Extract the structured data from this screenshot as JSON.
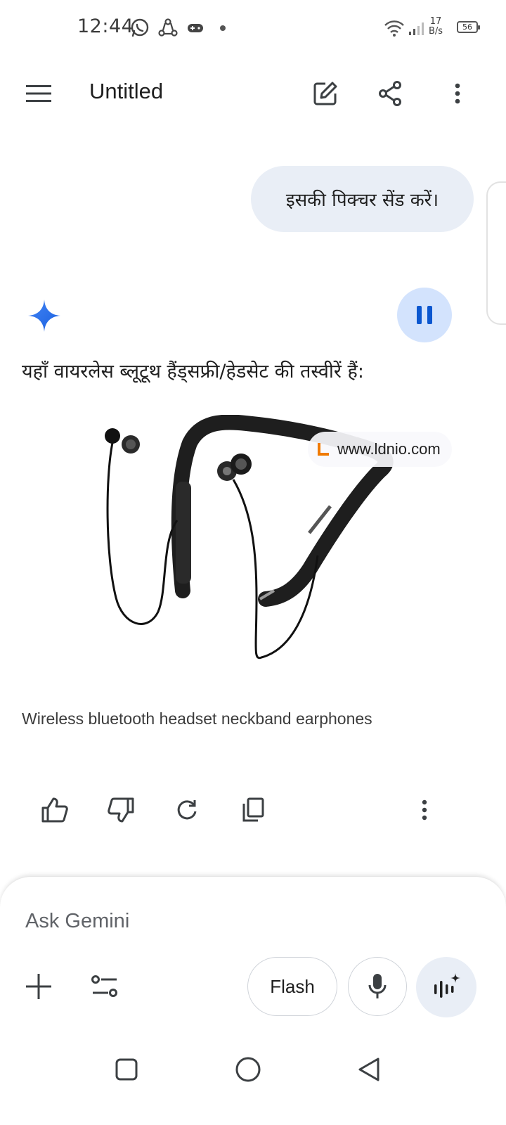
{
  "status_bar": {
    "time": "12:44",
    "net_speed_value": "17",
    "net_speed_unit": "B/s",
    "battery": "56"
  },
  "app_bar": {
    "title": "Untitled"
  },
  "conversation": {
    "user_message": "इसकी पिक्चर सेंड करें।",
    "response_text": "यहाँ वायरलेस ब्लूटूथ हैंड्सफ्री/हेडसेट की तस्वीरें हैं:",
    "image_source": "www.ldnio.com",
    "image_caption": "Wireless bluetooth headset neckband earphones"
  },
  "input": {
    "placeholder": "Ask Gemini",
    "model_label": "Flash"
  },
  "icons": {
    "menu": "menu-icon",
    "new_chat": "edit-icon",
    "share": "share-icon",
    "more": "more-vert-icon",
    "gemini": "gemini-sparkle-icon",
    "pause": "pause-icon",
    "thumb_up": "thumb-up-icon",
    "thumb_down": "thumb-down-icon",
    "regenerate": "refresh-icon",
    "copy": "copy-icon",
    "add": "add-icon",
    "tools": "tune-icon",
    "mic": "mic-icon",
    "live": "live-icon"
  },
  "colors": {
    "accent": "#0b57d0",
    "user_bubble": "#e9eef6",
    "pause_bg": "#d3e3fd",
    "source_logo": "#f07a00"
  }
}
